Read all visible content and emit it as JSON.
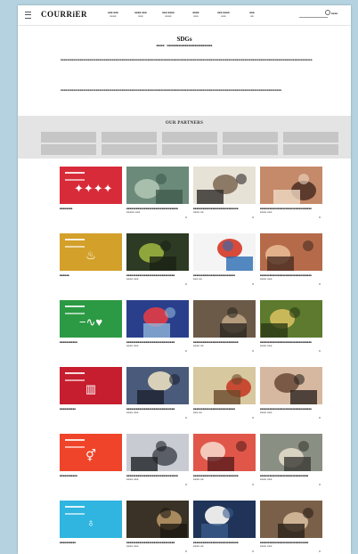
{
  "header": {
    "logo": "COURRiER",
    "nav": [
      {
        "label": "■■■ ■■■",
        "sub": "■■■■"
      },
      {
        "label": "■■■■ ■■■",
        "sub": "■■■"
      },
      {
        "label": "■■■ ■■■■",
        "sub": "■■■■"
      },
      {
        "label": "■■■■",
        "sub": "■■■"
      },
      {
        "label": "■■■ ■■■■",
        "sub": "■■■"
      },
      {
        "label": "■■■",
        "sub": "■■"
      }
    ],
    "search_placeholder": "",
    "button_label": "■■■■"
  },
  "intro": {
    "title": "SDGs",
    "subtitle": "■■■■■・■■■■■■■■■■■■■■■■■■■■■■■■■■■■",
    "paragraphs": [
      "■■■■■■■■■■■■■■■■■■■■■■■■■■■■■■■■■■■■■■■■■■■■■■■■■■■■■■■■■■■■■■■■■■■■■■■■■■■■■■■■■■■■■■■■■■■■■■■■■■■■■■■■■■■■■■■■■■■■■■■■■■■■■■■■■■■■■■■■■■■■■■■■■■■■■■■■■■■■",
      "■■■■■■■■■■■■■■■■■■■■■■■■■■■■■■■■■■■■■■■■■■■■■■■■■■■■■■■■■■■■■■■■■■■■■■■■■■■■■■■■■■■■■■■■■■■■■■■■■■■■■■■■■■■■■■■■■■■■■■■■■■■■■■■■■■■■■■■■■"
    ]
  },
  "partners": {
    "title": "OUR PARTNERS",
    "count": 10
  },
  "sdg_rows": [
    {
      "color": "#d82b3a",
      "icon": "people-icon",
      "symbol": "✦✦✦✦",
      "caption": "■■■■■■■■",
      "articles": [
        {
          "caption": "■■■■■■■■■■■■■■■■■■■■■■■■■■■■■■■■",
          "tag": "■■■■■ ■■■"
        },
        {
          "caption": "■■■■■■■■■■■■■■■■■■■■■■■■■■■■",
          "tag": "■■■■ ■■"
        },
        {
          "caption": "■■■■■■■■■■■■■■■■■■■■■■■■■■■■■■■■",
          "tag": "■■■■ ■■■"
        }
      ]
    },
    {
      "color": "#d3a02a",
      "icon": "food-bowl-icon",
      "symbol": "♨",
      "caption": "■■■■■■",
      "articles": [
        {
          "caption": "■■■■■■■■■■■■■■■■■■■■■■■■■■■■■■",
          "tag": "■■■■ ■■■"
        },
        {
          "caption": "■■■■■■■■■■■■■■■■■■■■■■■■■■",
          "tag": "■■■ ■■"
        },
        {
          "caption": "■■■■■■■■■■■■■■■■■■■■■■■■■■■■■■■■",
          "tag": "■■■■ ■■■"
        }
      ]
    },
    {
      "color": "#2c9a44",
      "icon": "heartbeat-icon",
      "symbol": "−∿♥",
      "caption": "■■■■■■■■■■■",
      "articles": [
        {
          "caption": "■■■■■■■■■■■■■■■■■■■■■■■■■■■■■■",
          "tag": "■■■■ ■■■"
        },
        {
          "caption": "■■■■■■■■■■■■■■■■■■■■■■■■■■■■",
          "tag": "■■■■ ■■"
        },
        {
          "caption": "■■■■■■■■■■■■■■■■■■■■■■■■■■■■■■■■",
          "tag": "■■■■ ■■■"
        }
      ]
    },
    {
      "color": "#c61e2e",
      "icon": "book-icon",
      "symbol": "▥",
      "caption": "■■■■■■■■■■",
      "articles": [
        {
          "caption": "■■■■■■■■■■■■■■■■■■■■■■■■■■■■■■",
          "tag": "■■■■ ■■■"
        },
        {
          "caption": "■■■■■■■■■■■■■■■■■■■■■■■■■■",
          "tag": "■■■ ■■"
        },
        {
          "caption": "■■■■■■■■■■■■■■■■■■■■■■■■■■■■■■■■",
          "tag": "■■■■ ■■■"
        }
      ]
    },
    {
      "color": "#ef4429",
      "icon": "gender-equality-icon",
      "symbol": "⚥",
      "caption": "■■■■■■■■■■■",
      "articles": [
        {
          "caption": "■■■■■■■■■■■■■■■■■■■■■■■■■■■■■■■■",
          "tag": "■■■■ ■■■"
        },
        {
          "caption": "■■■■■■■■■■■■■■■■■■■■■■■■■■■■",
          "tag": "■■■■ ■■"
        },
        {
          "caption": "■■■■■■■■■■■■■■■■■■■■■■■■■■■■■■",
          "tag": "■■■■ ■■■"
        }
      ]
    },
    {
      "color": "#2fb5df",
      "icon": "water-drop-icon",
      "symbol": "♁",
      "caption": "■■■■■■■■■■",
      "articles": [
        {
          "caption": "■■■■■■■■■■■■■■■■■■■■■■■■■■■■■■",
          "tag": "■■■■ ■■■"
        },
        {
          "caption": "■■■■■■■■■■■■■■■■■■■■■■■■■■■■",
          "tag": "■■■■ ■■"
        },
        {
          "caption": "■■■■■■■■■■■■■■■■■■■■■■■■■■■■■■",
          "tag": "■■■■ ■■■"
        }
      ]
    }
  ],
  "thumb_palettes": [
    [
      "#6c8a7a",
      "#a9bfae",
      "#3e5a4c"
    ],
    [
      "#e7e2d6",
      "#8c7a66",
      "#2e2a28"
    ],
    [
      "#c58a6a",
      "#5c3a2c",
      "#efd9c4"
    ],
    [
      "#2d3a24",
      "#8fa63c",
      "#1a2314"
    ],
    [
      "#f4f4f4",
      "#d84b3a",
      "#2a6bb3"
    ],
    [
      "#b56b4a",
      "#e2b08a",
      "#4a2d22"
    ],
    [
      "#2a3f8c",
      "#d13c4c",
      "#8fb5d9"
    ],
    [
      "#6b5a48",
      "#b39b7c",
      "#2c2822"
    ],
    [
      "#5d7a2e",
      "#c9b85a",
      "#2a3a14"
    ],
    [
      "#4a5a7a",
      "#d8d0b8",
      "#1c2230"
    ],
    [
      "#d8c8a0",
      "#c84a32",
      "#6a4a2c"
    ],
    [
      "#d6b8a0",
      "#7a5a46",
      "#2c2420"
    ],
    [
      "#c8ccd2",
      "#5a5e66",
      "#1e2024"
    ],
    [
      "#e0574a",
      "#f4c9bc",
      "#5a1c1c"
    ],
    [
      "#8a8f84",
      "#d9d3c2",
      "#3a3a34"
    ],
    [
      "#3a3226",
      "#a88a5e",
      "#1c1812"
    ],
    [
      "#1f3458",
      "#e8e8e8",
      "#3a5a8a"
    ],
    [
      "#7a6048",
      "#cdb294",
      "#2a2018"
    ]
  ]
}
